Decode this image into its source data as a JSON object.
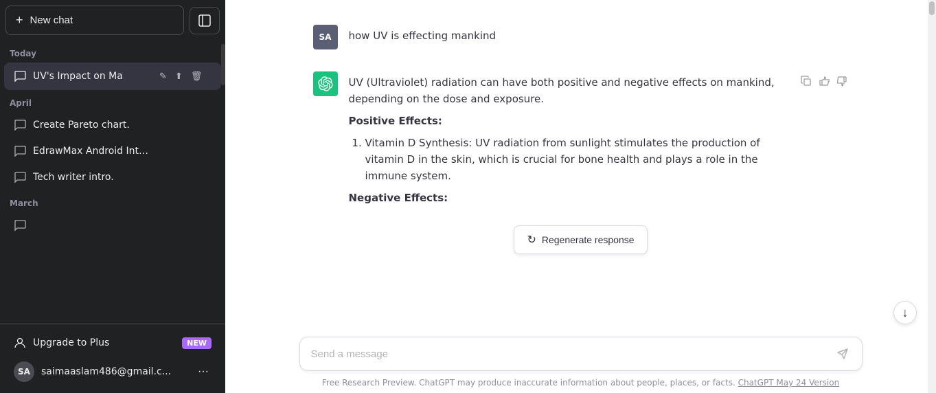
{
  "sidebar": {
    "new_chat_label": "New chat",
    "toggle_icon": "⊞",
    "sections": [
      {
        "label": "Today",
        "items": [
          {
            "id": "uv-impact",
            "text": "UV's Impact on Ma",
            "active": true,
            "show_actions": true
          }
        ]
      },
      {
        "label": "April",
        "items": [
          {
            "id": "pareto",
            "text": "Create Pareto chart.",
            "active": false
          },
          {
            "id": "edrawmax",
            "text": "EdrawMax Android Interface",
            "active": false
          },
          {
            "id": "tech-writer",
            "text": "Tech writer intro.",
            "active": false
          }
        ]
      },
      {
        "label": "March",
        "items": [
          {
            "id": "march-item",
            "text": "",
            "active": false
          }
        ]
      }
    ],
    "upgrade": {
      "label": "Upgrade to Plus",
      "badge": "NEW"
    },
    "user": {
      "initials": "SA",
      "email": "saimaaslam486@gmail.c...",
      "menu_icon": "···"
    }
  },
  "chat": {
    "messages": [
      {
        "role": "user",
        "avatar_initials": "SA",
        "text": "how UV is effecting mankind"
      },
      {
        "role": "assistant",
        "intro": "UV (Ultraviolet) radiation can have both positive and negative effects on mankind, depending on the dose and exposure.",
        "positive_title": "Positive Effects:",
        "items": [
          "Vitamin D Synthesis: UV radiation from sunlight stimulates the production of vitamin D in the skin, which is crucial for bone health and plays a role in the immune system."
        ],
        "negative_title": "Negative Effects:"
      }
    ],
    "regenerate_label": "Regenerate response",
    "scroll_down_icon": "↓",
    "input_placeholder": "Send a message",
    "send_icon": "➤",
    "disclaimer_text": "Free Research Preview. ChatGPT may produce inaccurate information about people, places, or facts.",
    "disclaimer_link": "ChatGPT May 24 Version"
  },
  "icons": {
    "new_chat": "+",
    "sidebar_toggle": "▣",
    "chat_bubble": "💬",
    "copy": "⧉",
    "thumbs_up": "👍",
    "thumbs_down": "👎",
    "regenerate": "↻",
    "person": "👤",
    "ellipsis": "···"
  }
}
